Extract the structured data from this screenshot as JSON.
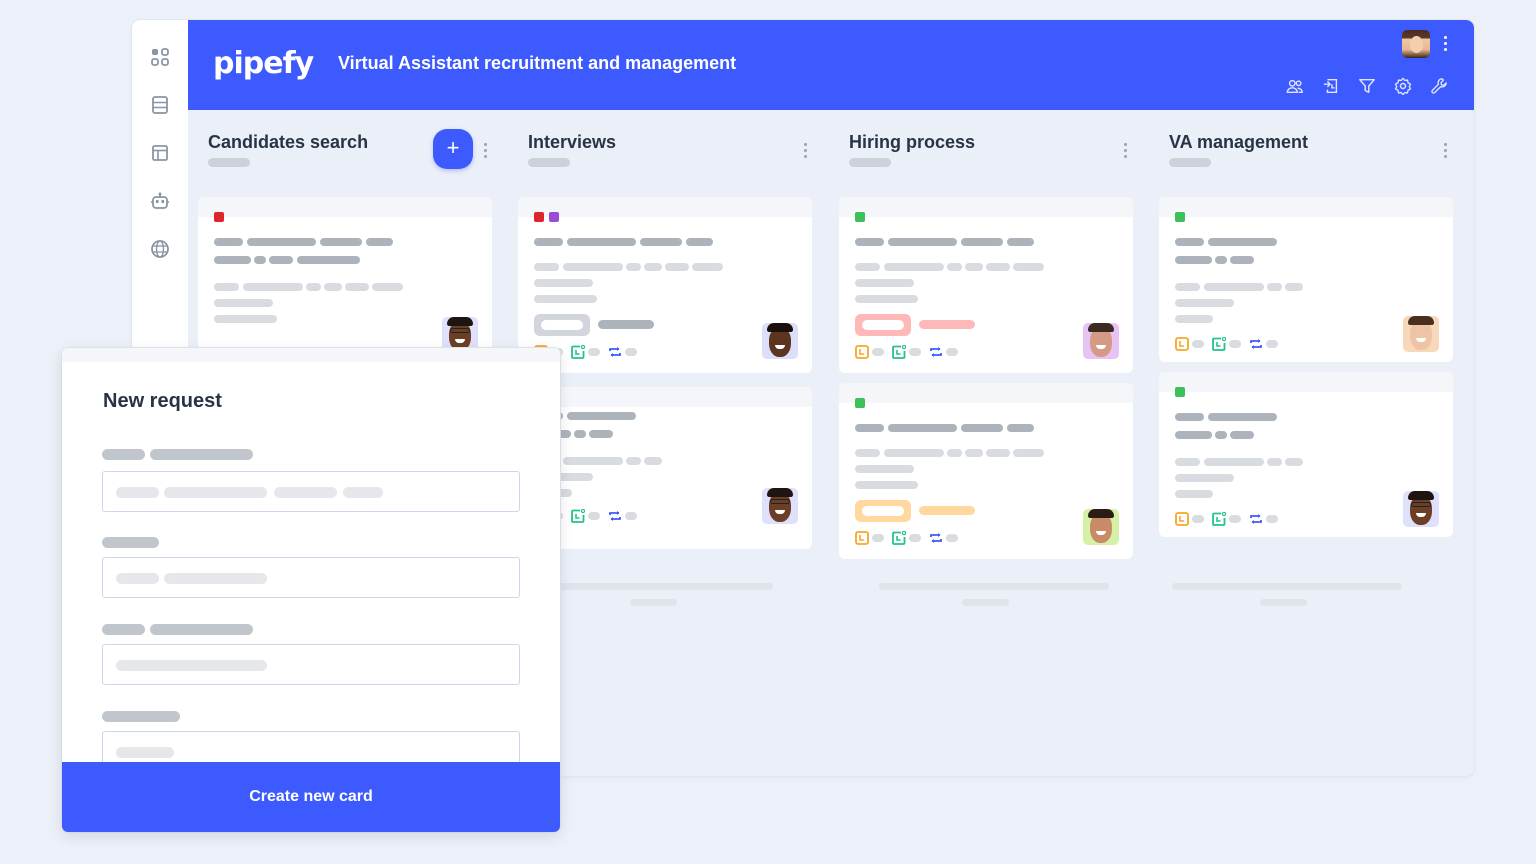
{
  "app": {
    "logo": "pipefy",
    "pipe_title": "Virtual Assistant recruitment and management",
    "brand_color": "#3d5afe"
  },
  "rail": {
    "items": [
      {
        "icon": "apps-grid-icon"
      },
      {
        "icon": "database-icon"
      },
      {
        "icon": "layout-icon"
      },
      {
        "icon": "robot-icon"
      },
      {
        "icon": "globe-icon"
      }
    ]
  },
  "topbar": {
    "actions": [
      {
        "icon": "members-icon"
      },
      {
        "icon": "import-icon"
      },
      {
        "icon": "filter-icon"
      },
      {
        "icon": "settings-icon"
      },
      {
        "icon": "wrench-icon"
      }
    ]
  },
  "phases": [
    {
      "title": "Candidates search",
      "add_label": "+"
    },
    {
      "title": "Interviews"
    },
    {
      "title": "Hiring process"
    },
    {
      "title": "VA management"
    }
  ],
  "label_colors": {
    "red": "#e0242c",
    "purple": "#9b4dd6",
    "green": "#3dbf5a"
  },
  "status_colors": {
    "gray": "#d2d6dc",
    "pink": "#ffb8b8",
    "orange": "#ffd8a0"
  },
  "modal": {
    "title": "New request",
    "submit_label": "Create new card"
  }
}
